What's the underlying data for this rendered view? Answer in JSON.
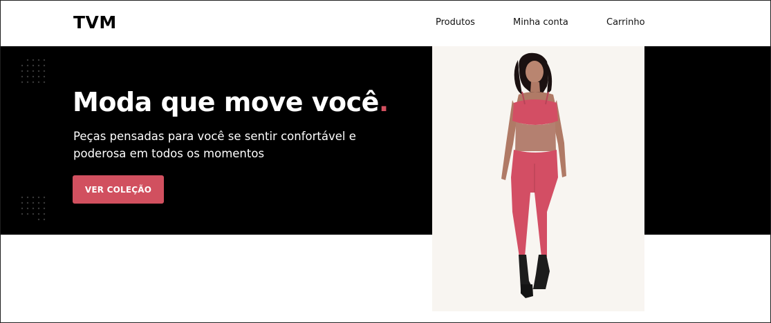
{
  "header": {
    "logo": "TVM",
    "nav": [
      "Produtos",
      "Minha conta",
      "Carrinho"
    ]
  },
  "hero": {
    "headline": "Moda que move você",
    "headline_accent": ".",
    "subtitle": "Peças pensadas para você se sentir confortável e poderosa em todos os momentos",
    "cta_label": "VER COLEÇÃO"
  },
  "colors": {
    "accent": "#d1505f",
    "hero_background": "#000000",
    "photo_background": "#f8f5f1"
  },
  "icons": [
    "dot-grid-decoration",
    "dot-grid-decoration"
  ]
}
